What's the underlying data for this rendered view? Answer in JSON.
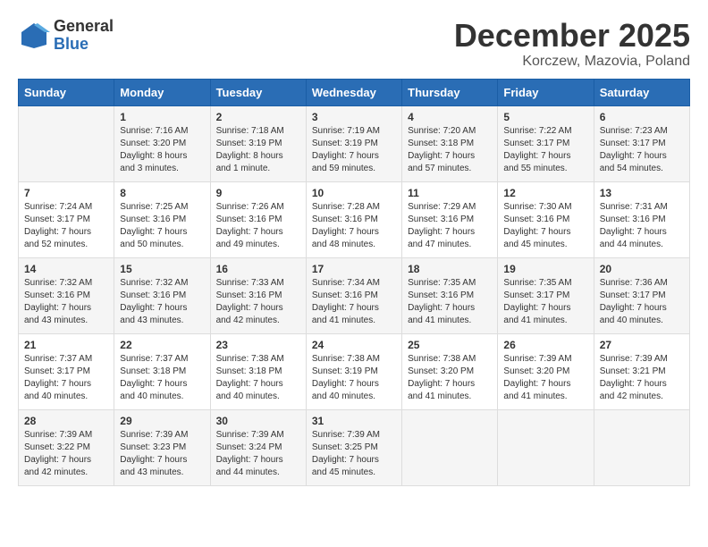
{
  "header": {
    "logo_general": "General",
    "logo_blue": "Blue",
    "month_title": "December 2025",
    "location": "Korczew, Mazovia, Poland"
  },
  "days_of_week": [
    "Sunday",
    "Monday",
    "Tuesday",
    "Wednesday",
    "Thursday",
    "Friday",
    "Saturday"
  ],
  "weeks": [
    [
      {
        "day": "",
        "info": ""
      },
      {
        "day": "1",
        "info": "Sunrise: 7:16 AM\nSunset: 3:20 PM\nDaylight: 8 hours\nand 3 minutes."
      },
      {
        "day": "2",
        "info": "Sunrise: 7:18 AM\nSunset: 3:19 PM\nDaylight: 8 hours\nand 1 minute."
      },
      {
        "day": "3",
        "info": "Sunrise: 7:19 AM\nSunset: 3:19 PM\nDaylight: 7 hours\nand 59 minutes."
      },
      {
        "day": "4",
        "info": "Sunrise: 7:20 AM\nSunset: 3:18 PM\nDaylight: 7 hours\nand 57 minutes."
      },
      {
        "day": "5",
        "info": "Sunrise: 7:22 AM\nSunset: 3:17 PM\nDaylight: 7 hours\nand 55 minutes."
      },
      {
        "day": "6",
        "info": "Sunrise: 7:23 AM\nSunset: 3:17 PM\nDaylight: 7 hours\nand 54 minutes."
      }
    ],
    [
      {
        "day": "7",
        "info": "Sunrise: 7:24 AM\nSunset: 3:17 PM\nDaylight: 7 hours\nand 52 minutes."
      },
      {
        "day": "8",
        "info": "Sunrise: 7:25 AM\nSunset: 3:16 PM\nDaylight: 7 hours\nand 50 minutes."
      },
      {
        "day": "9",
        "info": "Sunrise: 7:26 AM\nSunset: 3:16 PM\nDaylight: 7 hours\nand 49 minutes."
      },
      {
        "day": "10",
        "info": "Sunrise: 7:28 AM\nSunset: 3:16 PM\nDaylight: 7 hours\nand 48 minutes."
      },
      {
        "day": "11",
        "info": "Sunrise: 7:29 AM\nSunset: 3:16 PM\nDaylight: 7 hours\nand 47 minutes."
      },
      {
        "day": "12",
        "info": "Sunrise: 7:30 AM\nSunset: 3:16 PM\nDaylight: 7 hours\nand 45 minutes."
      },
      {
        "day": "13",
        "info": "Sunrise: 7:31 AM\nSunset: 3:16 PM\nDaylight: 7 hours\nand 44 minutes."
      }
    ],
    [
      {
        "day": "14",
        "info": "Sunrise: 7:32 AM\nSunset: 3:16 PM\nDaylight: 7 hours\nand 43 minutes."
      },
      {
        "day": "15",
        "info": "Sunrise: 7:32 AM\nSunset: 3:16 PM\nDaylight: 7 hours\nand 43 minutes."
      },
      {
        "day": "16",
        "info": "Sunrise: 7:33 AM\nSunset: 3:16 PM\nDaylight: 7 hours\nand 42 minutes."
      },
      {
        "day": "17",
        "info": "Sunrise: 7:34 AM\nSunset: 3:16 PM\nDaylight: 7 hours\nand 41 minutes."
      },
      {
        "day": "18",
        "info": "Sunrise: 7:35 AM\nSunset: 3:16 PM\nDaylight: 7 hours\nand 41 minutes."
      },
      {
        "day": "19",
        "info": "Sunrise: 7:35 AM\nSunset: 3:17 PM\nDaylight: 7 hours\nand 41 minutes."
      },
      {
        "day": "20",
        "info": "Sunrise: 7:36 AM\nSunset: 3:17 PM\nDaylight: 7 hours\nand 40 minutes."
      }
    ],
    [
      {
        "day": "21",
        "info": "Sunrise: 7:37 AM\nSunset: 3:17 PM\nDaylight: 7 hours\nand 40 minutes."
      },
      {
        "day": "22",
        "info": "Sunrise: 7:37 AM\nSunset: 3:18 PM\nDaylight: 7 hours\nand 40 minutes."
      },
      {
        "day": "23",
        "info": "Sunrise: 7:38 AM\nSunset: 3:18 PM\nDaylight: 7 hours\nand 40 minutes."
      },
      {
        "day": "24",
        "info": "Sunrise: 7:38 AM\nSunset: 3:19 PM\nDaylight: 7 hours\nand 40 minutes."
      },
      {
        "day": "25",
        "info": "Sunrise: 7:38 AM\nSunset: 3:20 PM\nDaylight: 7 hours\nand 41 minutes."
      },
      {
        "day": "26",
        "info": "Sunrise: 7:39 AM\nSunset: 3:20 PM\nDaylight: 7 hours\nand 41 minutes."
      },
      {
        "day": "27",
        "info": "Sunrise: 7:39 AM\nSunset: 3:21 PM\nDaylight: 7 hours\nand 42 minutes."
      }
    ],
    [
      {
        "day": "28",
        "info": "Sunrise: 7:39 AM\nSunset: 3:22 PM\nDaylight: 7 hours\nand 42 minutes."
      },
      {
        "day": "29",
        "info": "Sunrise: 7:39 AM\nSunset: 3:23 PM\nDaylight: 7 hours\nand 43 minutes."
      },
      {
        "day": "30",
        "info": "Sunrise: 7:39 AM\nSunset: 3:24 PM\nDaylight: 7 hours\nand 44 minutes."
      },
      {
        "day": "31",
        "info": "Sunrise: 7:39 AM\nSunset: 3:25 PM\nDaylight: 7 hours\nand 45 minutes."
      },
      {
        "day": "",
        "info": ""
      },
      {
        "day": "",
        "info": ""
      },
      {
        "day": "",
        "info": ""
      }
    ]
  ]
}
